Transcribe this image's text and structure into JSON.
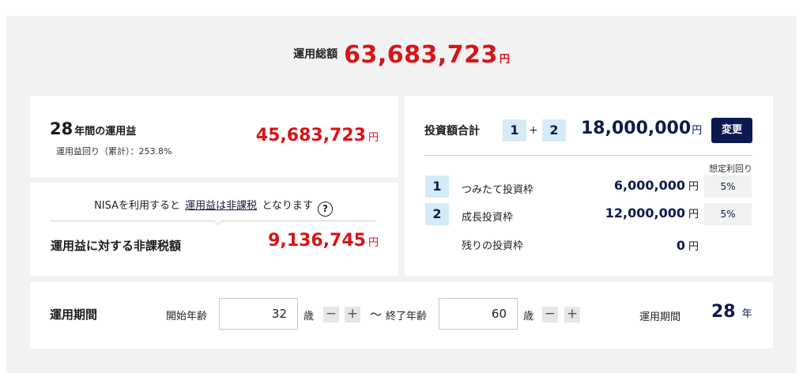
{
  "total": {
    "label": "運用総額",
    "value": "63,683,723",
    "unit": "円"
  },
  "profit": {
    "years": "28",
    "years_label": "年間の運用益",
    "rate_label": "運用益回り（累計）：253.8%",
    "value": "45,683,723",
    "unit": "円"
  },
  "tax": {
    "nisa_prefix": "NISAを利用すると",
    "nisa_link": "運用益は非課税",
    "nisa_suffix": "となります",
    "help_icon": "?",
    "label": "運用益に対する非課税額",
    "value": "9,136,745",
    "unit": "円"
  },
  "investment": {
    "title": "投資額合計",
    "badge1": "1",
    "plus": "+",
    "badge2": "2",
    "total": "18,000,000",
    "unit": "円",
    "change_button": "変更",
    "rate_header": "想定利回り",
    "rows": [
      {
        "badge": "1",
        "label": "つみたて投資枠",
        "amount": "6,000,000",
        "unit": "円",
        "rate": "5%"
      },
      {
        "badge": "2",
        "label": "成長投資枠",
        "amount": "12,000,000",
        "unit": "円",
        "rate": "5%"
      },
      {
        "badge": "",
        "label": "残りの投資枠",
        "amount": "0",
        "unit": "円",
        "rate": ""
      }
    ]
  },
  "period": {
    "title": "運用期間",
    "start_label": "開始年齢",
    "start_age": "32",
    "age_unit": "歳",
    "minus": "−",
    "plus": "+",
    "tilde": "〜",
    "end_label": "終了年齢",
    "end_age": "60",
    "result_label": "運用期間",
    "result_value": "28",
    "result_unit": "年"
  },
  "colors": {
    "accent_red": "#d71418",
    "navy": "#0d1a52",
    "badge_bg": "#d6ebf8",
    "frame_bg": "#f2f2f2"
  }
}
